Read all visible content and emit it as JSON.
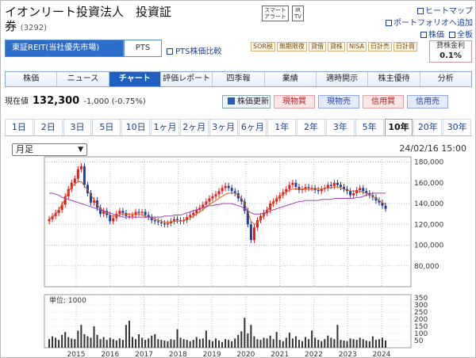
{
  "header": {
    "title_line1": "イオンリート投資法人　投資証",
    "title_line2": "券",
    "code": "(3292)",
    "smart_alert": "スマート\nアラート",
    "ir_tv": "IR\nTV",
    "links": {
      "heatmap": "ヒートマップ",
      "portfolio_add": "ポートフォリオへ追加",
      "stock_price": "株価",
      "all_view": "全板"
    }
  },
  "market_tabs": {
    "active": "東証REIT(当社優先市場)",
    "inactive": "PTS"
  },
  "pts_compare": "PTS株価比較",
  "tags": [
    "SOR税",
    "無期限夜",
    "貸借",
    "貸株",
    "NISA",
    "日計売",
    "日計買"
  ],
  "yield": {
    "label": "貸株金利",
    "value": "0.1%"
  },
  "nav": [
    "株価",
    "ニュース",
    "チャート",
    "評価レポート",
    "四季報",
    "業績",
    "適時開示",
    "株主優待",
    "分析"
  ],
  "nav_active_index": 2,
  "price": {
    "label": "現在値",
    "now": "132,300",
    "change": "-1,000 (-0.75%)"
  },
  "actions": {
    "update": "株価更新",
    "buy_cash": "現物買",
    "sell_cash": "現物売",
    "buy_margin": "信用買",
    "sell_margin": "信用売"
  },
  "range_tabs": [
    "1日",
    "2日",
    "3日",
    "5日",
    "10日",
    "1ヶ月",
    "2ヶ月",
    "3ヶ月",
    "6ヶ月",
    "1年",
    "2年",
    "3年",
    "5年",
    "10年",
    "20年",
    "30年"
  ],
  "range_active_index": 13,
  "period_select": "月足",
  "datetime": "24/02/16 15:00",
  "colors": {
    "up": "#e8181a",
    "down": "#1f3fa0",
    "ma_short": "#d4601a",
    "ma_long": "#a040b0",
    "volume": "#333333"
  },
  "chart_data": [
    {
      "type": "candlestick",
      "x_ticks": [
        "2015",
        "2016",
        "2017",
        "2018",
        "2019",
        "2020",
        "2021",
        "2022",
        "2023",
        "2024"
      ],
      "y_ticks": [
        80000,
        100000,
        120000,
        140000,
        160000,
        180000
      ],
      "y_tick_labels": [
        "80,000",
        "100,000",
        "120,000",
        "140,000",
        "160,000",
        "180,000"
      ],
      "ylim": [
        60000,
        185000
      ],
      "grid": true,
      "series": [
        {
          "kind": "price",
          "close": [
            125000,
            128000,
            131000,
            134000,
            139000,
            147000,
            154000,
            160000,
            164000,
            173000,
            176000,
            158000,
            150000,
            141000,
            143000,
            136000,
            130000,
            133000,
            129000,
            123000,
            126000,
            130000,
            133000,
            131000,
            128000,
            128000,
            129000,
            132000,
            131000,
            132000,
            129000,
            127000,
            124000,
            123000,
            122000,
            121000,
            120000,
            121000,
            123000,
            125000,
            124000,
            123000,
            124000,
            127000,
            129000,
            131000,
            134000,
            136000,
            139000,
            142000,
            145000,
            147000,
            149000,
            152000,
            155000,
            157000,
            155000,
            152000,
            150000,
            145000,
            142000,
            133000,
            120000,
            105000,
            117000,
            124000,
            128000,
            131000,
            134000,
            140000,
            142000,
            145000,
            148000,
            151000,
            154000,
            158000,
            160000,
            156000,
            153000,
            154000,
            156000,
            155000,
            155000,
            153000,
            152000,
            154000,
            155000,
            158000,
            157000,
            160000,
            158000,
            156000,
            154000,
            152000,
            148000,
            150000,
            153000,
            155000,
            152000,
            150000,
            148000,
            146000,
            143000,
            141000,
            138000,
            135000
          ]
        },
        {
          "kind": "ma_short",
          "name": "",
          "values": [
            125000,
            127000,
            130000,
            134000,
            139000,
            145000,
            151000,
            156000,
            159000,
            161000,
            161000,
            157000,
            153000,
            148000,
            144000,
            139000,
            135000,
            133000,
            131000,
            129000,
            128000,
            128000,
            129000,
            130000,
            130000,
            130000,
            130000,
            130000,
            130000,
            129000,
            128000,
            127000,
            126000,
            125000,
            124000,
            123000,
            122000,
            122000,
            122000,
            123000,
            123000,
            123000,
            124000,
            125000,
            126000,
            128000,
            130000,
            132000,
            134000,
            137000,
            139000,
            141000,
            143000,
            145000,
            147000,
            149000,
            150000,
            150000,
            150000,
            148000,
            145000,
            140000,
            132000,
            123000,
            120000,
            122000,
            125000,
            129000,
            133000,
            137000,
            141000,
            144000,
            147000,
            149000,
            151000,
            153000,
            154000,
            154000,
            154000,
            154000,
            154000,
            154000,
            154000,
            154000,
            154000,
            154000,
            155000,
            155000,
            155000,
            156000,
            156000,
            155000,
            154000,
            153000,
            152000,
            152000,
            152000,
            152000,
            151000,
            150000,
            149000,
            147000,
            145000,
            143000,
            141000,
            139000
          ]
        },
        {
          "kind": "ma_long",
          "name": "",
          "values": [
            150000,
            150000,
            149000,
            148000,
            146000,
            145000,
            144000,
            143000,
            142000,
            141000,
            140000,
            139000,
            138000,
            137000,
            136000,
            135000,
            134000,
            133000,
            132000,
            131000,
            130000,
            129000,
            128000,
            127000,
            127000,
            127000,
            127000,
            127000,
            127000,
            127000,
            127000,
            127000,
            127000,
            127000,
            127000,
            127000,
            128000,
            128000,
            128000,
            129000,
            129000,
            129000,
            130000,
            131000,
            132000,
            133000,
            134000,
            135000,
            136000,
            137000,
            138000,
            138000,
            139000,
            139000,
            140000,
            140000,
            140000,
            140000,
            139000,
            138000,
            137000,
            135000,
            133000,
            131000,
            130000,
            130000,
            130000,
            131000,
            132000,
            133000,
            134000,
            135000,
            136000,
            137000,
            138000,
            139000,
            140000,
            141000,
            142000,
            142000,
            143000,
            143000,
            143000,
            143000,
            143000,
            144000,
            144000,
            144000,
            144000,
            145000,
            145000,
            145000,
            145000,
            145000,
            145000,
            145000,
            146000,
            146000,
            147000,
            148000,
            149000,
            150000,
            150000,
            150000,
            150000,
            150000
          ]
        }
      ]
    },
    {
      "type": "bar",
      "label": "単位: 1000",
      "y_ticks": [
        50,
        100,
        150,
        200,
        250,
        300,
        350
      ],
      "ylim": [
        0,
        350
      ],
      "values": [
        60,
        80,
        70,
        55,
        90,
        110,
        75,
        65,
        60,
        120,
        160,
        95,
        80,
        70,
        150,
        90,
        60,
        75,
        55,
        70,
        60,
        50,
        65,
        55,
        160,
        190,
        75,
        60,
        95,
        70,
        55,
        65,
        85,
        95,
        60,
        55,
        50,
        45,
        60,
        55,
        130,
        70,
        60,
        55,
        45,
        55,
        75,
        60,
        65,
        120,
        55,
        45,
        65,
        50,
        40,
        60,
        55,
        45,
        65,
        90,
        115,
        210,
        100,
        160,
        80,
        60,
        55,
        70,
        65,
        85,
        60,
        110,
        55,
        45,
        70,
        105,
        65,
        80,
        55,
        45,
        75,
        60,
        120,
        70,
        55,
        45,
        60,
        85,
        70,
        60,
        160,
        55,
        50,
        45,
        65,
        60,
        55,
        70,
        60,
        50,
        45,
        80,
        55,
        60,
        70,
        50
      ]
    }
  ]
}
